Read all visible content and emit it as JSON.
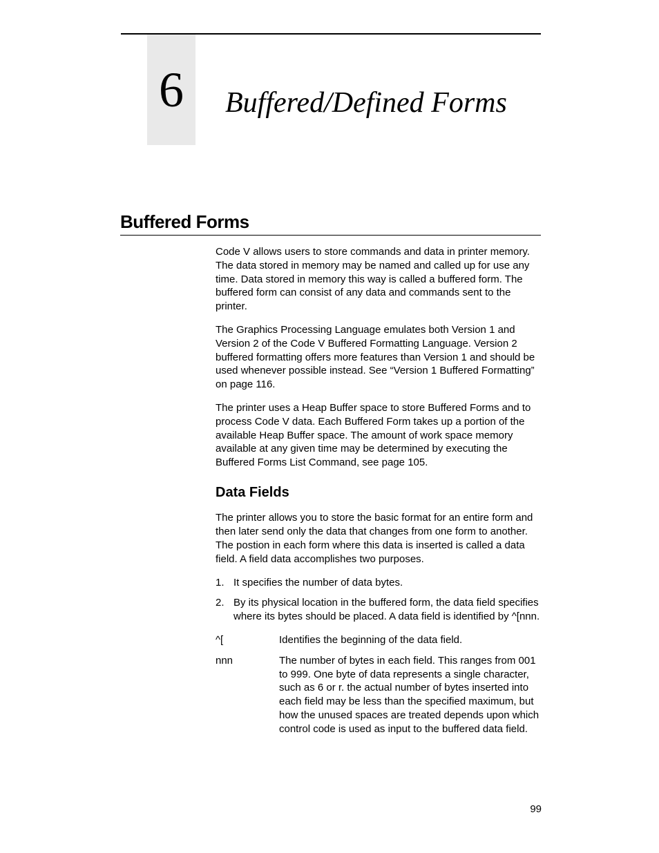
{
  "chapter": {
    "number": "6",
    "title": "Buffered/Defined Forms"
  },
  "h1": "Buffered Forms",
  "p1": "Code V allows users to store commands and data in printer memory. The data stored in memory may be named and called up for use any time. Data stored in memory this way is called a buffered form. The buffered form can consist of any data and commands sent to the printer.",
  "p2": "The Graphics Processing Language emulates both Version 1 and Version 2 of the Code V Buffered Formatting Language. Version 2 buffered formatting offers more features than Version 1 and should be used whenever possible instead. See “Version 1 Buffered Formatting” on page 116.",
  "p3": "The printer uses a Heap Buffer space to store Buffered Forms and to process Code V data. Each Buffered Form takes up a portion of the available Heap Buffer space. The amount of work space memory available at any given time may be determined by executing the Buffered Forms List Command, see page 105.",
  "h2": "Data Fields",
  "p4": "The printer allows you to store the basic format for an entire form and then later send only the data that changes from one form to another. The postion in each form where this data is inserted is called a data field. A field data accomplishes two purposes.",
  "list": {
    "n1": "1.",
    "t1": "It specifies the number of data bytes.",
    "n2": "2.",
    "t2": "By its physical location in the buffered form, the data field specifies where its bytes should be placed. A data field is identified by ^[nnn."
  },
  "defs": {
    "term1": "^[",
    "def1": "Identifies the beginning of the data field.",
    "term2": "nnn",
    "def2": "The number of bytes in each field. This ranges from 001 to 999. One byte of data represents a single character, such as 6 or r. the actual number of bytes inserted into each field may be less than the specified maximum, but how the unused spaces are treated depends upon which control code is used as input to the buffered data field."
  },
  "pagenum": "99"
}
